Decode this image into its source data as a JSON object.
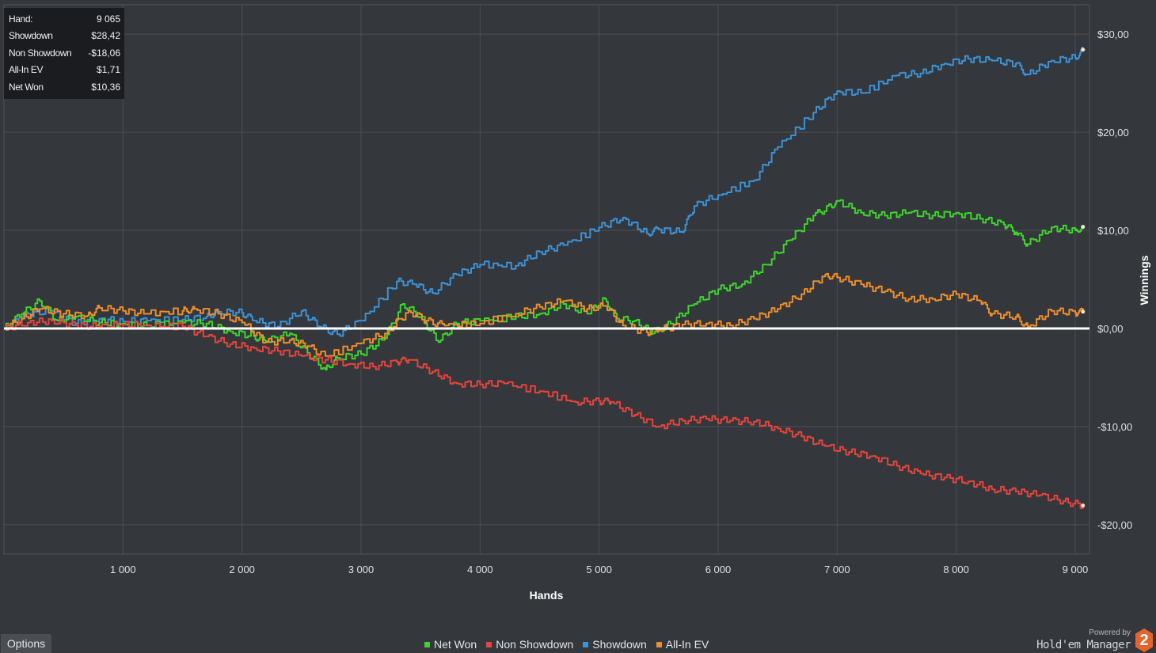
{
  "summary": {
    "rows": [
      {
        "label": "Hand:",
        "value": "9 065"
      },
      {
        "label": "Showdown",
        "value": "$28,42"
      },
      {
        "label": "Non Showdown",
        "value": "-$18,06"
      },
      {
        "label": "All-In EV",
        "value": "$1,71"
      },
      {
        "label": "Net Won",
        "value": "$10,36"
      }
    ]
  },
  "options_label": "Options",
  "legend": [
    {
      "label": "Net Won",
      "color": "#3ed42b"
    },
    {
      "label": "Non Showdown",
      "color": "#e6443c"
    },
    {
      "label": "Showdown",
      "color": "#3c92d6"
    },
    {
      "label": "All-In EV",
      "color": "#ee8e2a"
    }
  ],
  "branding": {
    "powered": "Powered by",
    "name": "Hold'em Manager",
    "logo": "2"
  },
  "chart_data": {
    "type": "line",
    "xlabel": "Hands",
    "ylabel": "Winnings",
    "xlim": [
      0,
      9120
    ],
    "ylim": [
      -23,
      33
    ],
    "x_ticks": [
      1000,
      2000,
      3000,
      4000,
      5000,
      6000,
      7000,
      8000,
      9000
    ],
    "x_tick_labels": [
      "1 000",
      "2 000",
      "3 000",
      "4 000",
      "5 000",
      "6 000",
      "7 000",
      "8 000",
      "9 000"
    ],
    "y_ticks": [
      30,
      20,
      10,
      0,
      -10,
      -20
    ],
    "y_tick_labels": [
      "$30,00",
      "$20,00",
      "$10,00",
      "$0,00",
      "-$10,00",
      "-$20,00"
    ],
    "grid": true,
    "legend_position": "bottom-center",
    "zero_line": true,
    "series": [
      {
        "name": "Showdown",
        "color": "#3c92d6",
        "points": [
          [
            0,
            0
          ],
          [
            200,
            1.5
          ],
          [
            400,
            1.8
          ],
          [
            600,
            0.5
          ],
          [
            800,
            1.0
          ],
          [
            1000,
            0.7
          ],
          [
            1200,
            0.8
          ],
          [
            1500,
            0.9
          ],
          [
            1700,
            1.2
          ],
          [
            1800,
            1.7
          ],
          [
            2000,
            1.6
          ],
          [
            2100,
            0.8
          ],
          [
            2300,
            0.2
          ],
          [
            2500,
            1.8
          ],
          [
            2650,
            0.2
          ],
          [
            2800,
            -0.6
          ],
          [
            3000,
            0.8
          ],
          [
            3300,
            4.8
          ],
          [
            3450,
            4.5
          ],
          [
            3600,
            3.6
          ],
          [
            3800,
            5.5
          ],
          [
            4000,
            6.5
          ],
          [
            4300,
            6.4
          ],
          [
            4500,
            7.8
          ],
          [
            4700,
            8.5
          ],
          [
            5000,
            10.3
          ],
          [
            5200,
            11.3
          ],
          [
            5400,
            9.7
          ],
          [
            5500,
            10.1
          ],
          [
            5700,
            9.8
          ],
          [
            5800,
            12.5
          ],
          [
            6000,
            13.6
          ],
          [
            6300,
            15.1
          ],
          [
            6500,
            18.5
          ],
          [
            6800,
            22.0
          ],
          [
            7000,
            24.2
          ],
          [
            7200,
            24.0
          ],
          [
            7500,
            25.8
          ],
          [
            7700,
            26.0
          ],
          [
            7900,
            27.0
          ],
          [
            8100,
            27.5
          ],
          [
            8300,
            27.3
          ],
          [
            8500,
            27.0
          ],
          [
            8600,
            25.9
          ],
          [
            8800,
            27.3
          ],
          [
            9000,
            27.6
          ],
          [
            9065,
            28.42
          ]
        ]
      },
      {
        "name": "Net Won",
        "color": "#3ed42b",
        "points": [
          [
            0,
            0
          ],
          [
            150,
            1.5
          ],
          [
            300,
            2.8
          ],
          [
            450,
            0.8
          ],
          [
            600,
            1.2
          ],
          [
            800,
            0.6
          ],
          [
            1000,
            0.5
          ],
          [
            1200,
            0.3
          ],
          [
            1500,
            0.6
          ],
          [
            1700,
            0.5
          ],
          [
            1900,
            -0.3
          ],
          [
            2100,
            -0.8
          ],
          [
            2200,
            -1.3
          ],
          [
            2400,
            -0.5
          ],
          [
            2550,
            -2.5
          ],
          [
            2700,
            -4.2
          ],
          [
            2800,
            -3.0
          ],
          [
            3000,
            -2.6
          ],
          [
            3200,
            -1.0
          ],
          [
            3350,
            2.5
          ],
          [
            3500,
            1.2
          ],
          [
            3650,
            -1.4
          ],
          [
            3800,
            0.5
          ],
          [
            4000,
            0.8
          ],
          [
            4300,
            1.2
          ],
          [
            4500,
            1.5
          ],
          [
            4700,
            2.5
          ],
          [
            4900,
            1.5
          ],
          [
            5050,
            3.0
          ],
          [
            5150,
            1.0
          ],
          [
            5300,
            0.8
          ],
          [
            5450,
            -0.5
          ],
          [
            5600,
            0.5
          ],
          [
            5800,
            2.5
          ],
          [
            6000,
            4.0
          ],
          [
            6200,
            4.5
          ],
          [
            6400,
            6.5
          ],
          [
            6600,
            9.0
          ],
          [
            6800,
            11.5
          ],
          [
            6950,
            12.5
          ],
          [
            7000,
            13.0
          ],
          [
            7200,
            11.8
          ],
          [
            7400,
            11.5
          ],
          [
            7600,
            11.8
          ],
          [
            7800,
            11.5
          ],
          [
            8000,
            11.8
          ],
          [
            8200,
            11.2
          ],
          [
            8400,
            10.6
          ],
          [
            8500,
            9.8
          ],
          [
            8600,
            8.6
          ],
          [
            8800,
            10.3
          ],
          [
            9000,
            10.0
          ],
          [
            9065,
            10.36
          ]
        ]
      },
      {
        "name": "All-In EV",
        "color": "#ee8e2a",
        "points": [
          [
            0,
            0
          ],
          [
            150,
            1.0
          ],
          [
            300,
            2.0
          ],
          [
            500,
            1.5
          ],
          [
            700,
            1.3
          ],
          [
            800,
            2.1
          ],
          [
            1000,
            1.8
          ],
          [
            1200,
            1.5
          ],
          [
            1500,
            1.8
          ],
          [
            1600,
            2.0
          ],
          [
            1800,
            1.5
          ],
          [
            2000,
            0.6
          ],
          [
            2200,
            -1.4
          ],
          [
            2400,
            -1.2
          ],
          [
            2550,
            -1.8
          ],
          [
            2700,
            -2.8
          ],
          [
            3000,
            -1.5
          ],
          [
            3200,
            -0.5
          ],
          [
            3400,
            1.8
          ],
          [
            3550,
            0.8
          ],
          [
            3700,
            0.3
          ],
          [
            4000,
            0.5
          ],
          [
            4300,
            1.5
          ],
          [
            4500,
            2.2
          ],
          [
            4700,
            2.8
          ],
          [
            4900,
            2.0
          ],
          [
            5050,
            2.3
          ],
          [
            5200,
            0.3
          ],
          [
            5400,
            -0.4
          ],
          [
            5500,
            -0.2
          ],
          [
            5700,
            0.4
          ],
          [
            5900,
            0.5
          ],
          [
            6100,
            0.3
          ],
          [
            6300,
            1.0
          ],
          [
            6500,
            2.0
          ],
          [
            6700,
            3.5
          ],
          [
            6900,
            5.5
          ],
          [
            7000,
            5.2
          ],
          [
            7200,
            4.5
          ],
          [
            7400,
            3.8
          ],
          [
            7600,
            3.0
          ],
          [
            7800,
            3.0
          ],
          [
            8000,
            3.5
          ],
          [
            8200,
            2.8
          ],
          [
            8300,
            1.5
          ],
          [
            8500,
            1.2
          ],
          [
            8600,
            0.2
          ],
          [
            8800,
            1.8
          ],
          [
            9000,
            1.6
          ],
          [
            9065,
            1.71
          ]
        ]
      },
      {
        "name": "Non Showdown",
        "color": "#e6443c",
        "points": [
          [
            0,
            0
          ],
          [
            200,
            0.6
          ],
          [
            400,
            0.8
          ],
          [
            600,
            0.3
          ],
          [
            800,
            0.2
          ],
          [
            1000,
            0.4
          ],
          [
            1200,
            0.3
          ],
          [
            1500,
            0.2
          ],
          [
            1700,
            -0.8
          ],
          [
            1900,
            -1.6
          ],
          [
            2100,
            -2.0
          ],
          [
            2300,
            -2.3
          ],
          [
            2500,
            -2.8
          ],
          [
            2700,
            -3.2
          ],
          [
            2900,
            -3.6
          ],
          [
            3100,
            -3.9
          ],
          [
            3300,
            -3.4
          ],
          [
            3400,
            -3.2
          ],
          [
            3600,
            -4.4
          ],
          [
            3800,
            -5.6
          ],
          [
            4000,
            -5.7
          ],
          [
            4200,
            -5.6
          ],
          [
            4500,
            -6.4
          ],
          [
            4800,
            -7.5
          ],
          [
            5000,
            -7.4
          ],
          [
            5100,
            -7.5
          ],
          [
            5300,
            -8.8
          ],
          [
            5500,
            -10.0
          ],
          [
            5700,
            -9.4
          ],
          [
            5900,
            -9.2
          ],
          [
            6100,
            -9.4
          ],
          [
            6300,
            -9.5
          ],
          [
            6500,
            -10.2
          ],
          [
            6700,
            -11.0
          ],
          [
            6900,
            -12.0
          ],
          [
            7100,
            -12.6
          ],
          [
            7300,
            -13.0
          ],
          [
            7500,
            -14.0
          ],
          [
            7700,
            -14.8
          ],
          [
            7900,
            -15.2
          ],
          [
            8100,
            -15.6
          ],
          [
            8300,
            -16.4
          ],
          [
            8500,
            -16.6
          ],
          [
            8700,
            -17.0
          ],
          [
            8900,
            -17.6
          ],
          [
            9065,
            -18.06
          ]
        ]
      }
    ]
  }
}
